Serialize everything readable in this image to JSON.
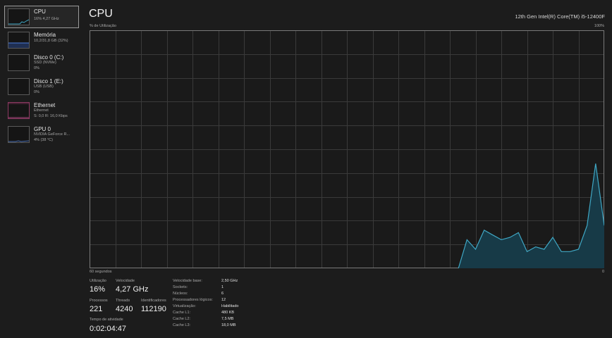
{
  "sidebar": {
    "items": [
      {
        "title": "CPU",
        "sub1": "16% 4,27 GHz",
        "sub2": ""
      },
      {
        "title": "Memória",
        "sub1": "10,2/31,8 GB (32%)",
        "sub2": ""
      },
      {
        "title": "Disco 0 (C:)",
        "sub1": "SSD (NVMe)",
        "sub2": "0%"
      },
      {
        "title": "Disco 1 (E:)",
        "sub1": "USB (USB)",
        "sub2": "0%"
      },
      {
        "title": "Ethernet",
        "sub1": "Ethernet",
        "sub2": "S: 0,0 R: 16,0 Kbps"
      },
      {
        "title": "GPU 0",
        "sub1": "NVIDIA GeForce R...",
        "sub2": "4% (38 °C)"
      }
    ]
  },
  "header": {
    "title": "CPU",
    "model": "12th Gen Intel(R) Core(TM) i5-12400F",
    "y_axis_label": "% de Utilização",
    "y_axis_max": "100%",
    "x_axis_left": "60 segundos",
    "x_axis_right": "0"
  },
  "chart_data": {
    "type": "area",
    "xlabel": "60 segundos",
    "ylabel": "% de Utilização",
    "ylim": [
      0,
      100
    ],
    "xlim": [
      60,
      0
    ],
    "grid": true,
    "color": "#3fa7c4",
    "x": [
      60,
      59,
      58,
      57,
      56,
      55,
      54,
      53,
      52,
      51,
      50,
      49,
      48,
      47,
      46,
      45,
      44,
      43,
      42,
      41,
      40,
      39,
      38,
      37,
      36,
      35,
      34,
      33,
      32,
      31,
      30,
      29,
      28,
      27,
      26,
      25,
      24,
      23,
      22,
      21,
      20,
      19,
      18,
      17,
      16,
      15,
      14,
      13,
      12,
      11,
      10,
      9,
      8,
      7,
      6,
      5,
      4,
      3,
      2,
      1,
      0
    ],
    "values": [
      0,
      0,
      0,
      0,
      0,
      0,
      0,
      0,
      0,
      0,
      0,
      0,
      0,
      0,
      0,
      0,
      0,
      0,
      0,
      0,
      0,
      0,
      0,
      0,
      0,
      0,
      0,
      0,
      0,
      0,
      0,
      0,
      0,
      0,
      0,
      0,
      0,
      0,
      0,
      0,
      0,
      0,
      0,
      0,
      12,
      8,
      16,
      14,
      12,
      13,
      15,
      7,
      9,
      8,
      13,
      7,
      7,
      8,
      18,
      44,
      18
    ]
  },
  "stats": {
    "utilizacao_label": "Utilização",
    "utilizacao_value": "16%",
    "velocidade_label": "Velocidade",
    "velocidade_value": "4,27 GHz",
    "processos_label": "Processos",
    "processos_value": "221",
    "threads_label": "Threads",
    "threads_value": "4240",
    "identificadores_label": "Identificadores",
    "identificadores_value": "112190",
    "tempo_label": "Tempo de atividade",
    "tempo_value": "0:02:04:47"
  },
  "details": [
    {
      "key": "Velocidade base:",
      "value": "2,50 GHz"
    },
    {
      "key": "Sockets:",
      "value": "1"
    },
    {
      "key": "Núcleos:",
      "value": "6"
    },
    {
      "key": "Processadores lógicos:",
      "value": "12"
    },
    {
      "key": "Virtualização:",
      "value": "Habilitado"
    },
    {
      "key": "Cache L1:",
      "value": "480 KB"
    },
    {
      "key": "Cache L2:",
      "value": "7,5 MB"
    },
    {
      "key": "Cache L3:",
      "value": "18,0 MB"
    }
  ],
  "colors": {
    "cpu_line": "#3fa7c4",
    "cpu_fill": "#173a47",
    "ethernet": "#a8477d",
    "gpu": "#4b6fb3",
    "memory": "#4b7bd9"
  }
}
